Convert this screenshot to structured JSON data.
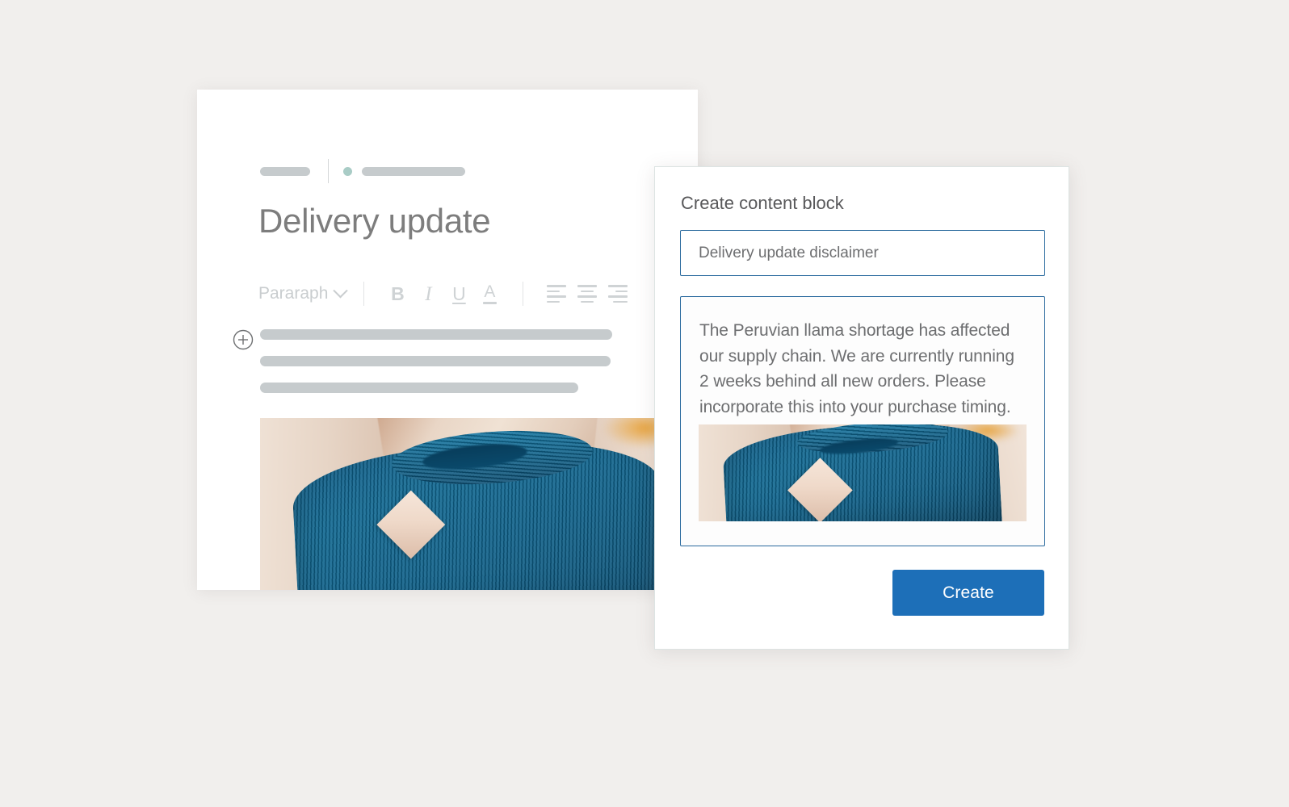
{
  "theme": {
    "page_background": "#f1efed",
    "card_background": "#ffffff",
    "accent_blue": "#1d6fb8",
    "field_border_blue": "#2a6a9e",
    "placeholder_gray": "#c6cbcd",
    "muted_text": "#6d6e70",
    "title_gray": "#7d7d7d",
    "breadcrumb_dot_teal": "#a9ccc6"
  },
  "editor": {
    "breadcrumb": {
      "name": "breadcrumb",
      "items": [
        "crumb-pill-short",
        "crumb-divider",
        "crumb-dot",
        "crumb-pill-long"
      ]
    },
    "document_title": "Delivery update",
    "toolbar": {
      "style_selector": {
        "label": "Pararaph",
        "icon": "chevron-down-icon"
      },
      "buttons": [
        {
          "id": "bold",
          "label": "B",
          "icon": "bold-icon"
        },
        {
          "id": "italic",
          "label": "I",
          "icon": "italic-icon"
        },
        {
          "id": "underline",
          "label": "U",
          "icon": "underline-icon"
        },
        {
          "id": "text-color",
          "label": "A",
          "icon": "text-color-icon"
        }
      ],
      "alignment": [
        {
          "id": "align-left",
          "icon": "align-left-icon"
        },
        {
          "id": "align-center",
          "icon": "align-center-icon"
        },
        {
          "id": "align-right",
          "icon": "align-right-icon"
        }
      ]
    },
    "add_block_icon": "plus-circle-icon",
    "body_placeholder_lines": 3,
    "hero_image_alt": "blue-knitted-sweater-in-gift-box"
  },
  "dialog": {
    "title": "Create content block",
    "name_input": {
      "value": "Delivery update disclaimer",
      "placeholder": "Block name"
    },
    "content_input": {
      "value": "The Peruvian llama shortage has affected our supply chain. We are currently running 2 weeks behind all new orders. Please incorporate this into your purchase timing.",
      "placeholder": "Add content",
      "embedded_image_alt": "blue-knitted-sweater-in-gift-box"
    },
    "create_button": {
      "label": "Create"
    }
  }
}
